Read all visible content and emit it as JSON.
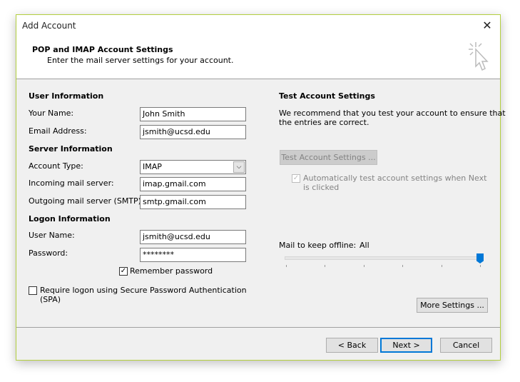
{
  "window": {
    "title": "Add Account",
    "accent": "#b3cf3f"
  },
  "header": {
    "title": "POP and IMAP Account Settings",
    "subtitle": "Enter the mail server settings for your account."
  },
  "user_info": {
    "heading": "User Information",
    "name_label": "Your Name:",
    "name_value": "John Smith",
    "email_label": "Email Address:",
    "email_value": "jsmith@ucsd.edu"
  },
  "server_info": {
    "heading": "Server Information",
    "type_label": "Account Type:",
    "type_value": "IMAP",
    "incoming_label": "Incoming mail server:",
    "incoming_value": "imap.gmail.com",
    "outgoing_label": "Outgoing mail server (SMTP):",
    "outgoing_value": "smtp.gmail.com"
  },
  "logon_info": {
    "heading": "Logon Information",
    "user_label": "User Name:",
    "user_value": "jsmith@ucsd.edu",
    "password_label": "Password:",
    "password_value": "********",
    "remember_label": "Remember password",
    "remember_checked": true,
    "spa_label_1": "Require logon using Secure Password Authentication",
    "spa_label_2": "(SPA)",
    "spa_checked": false
  },
  "test": {
    "heading": "Test Account Settings",
    "desc_1": "We recommend that you test your account to ensure that",
    "desc_2": "the entries are correct.",
    "button": "Test Account Settings ...",
    "auto_label_1": "Automatically test account settings when Next",
    "auto_label_2": "is clicked",
    "auto_checked": true
  },
  "offline": {
    "label": "Mail to keep offline:",
    "value": "All",
    "slider_fraction": 1.0,
    "thumb_color": "#0078d7"
  },
  "buttons": {
    "more": "More Settings ...",
    "back": "< Back",
    "next": "Next >",
    "cancel": "Cancel"
  }
}
